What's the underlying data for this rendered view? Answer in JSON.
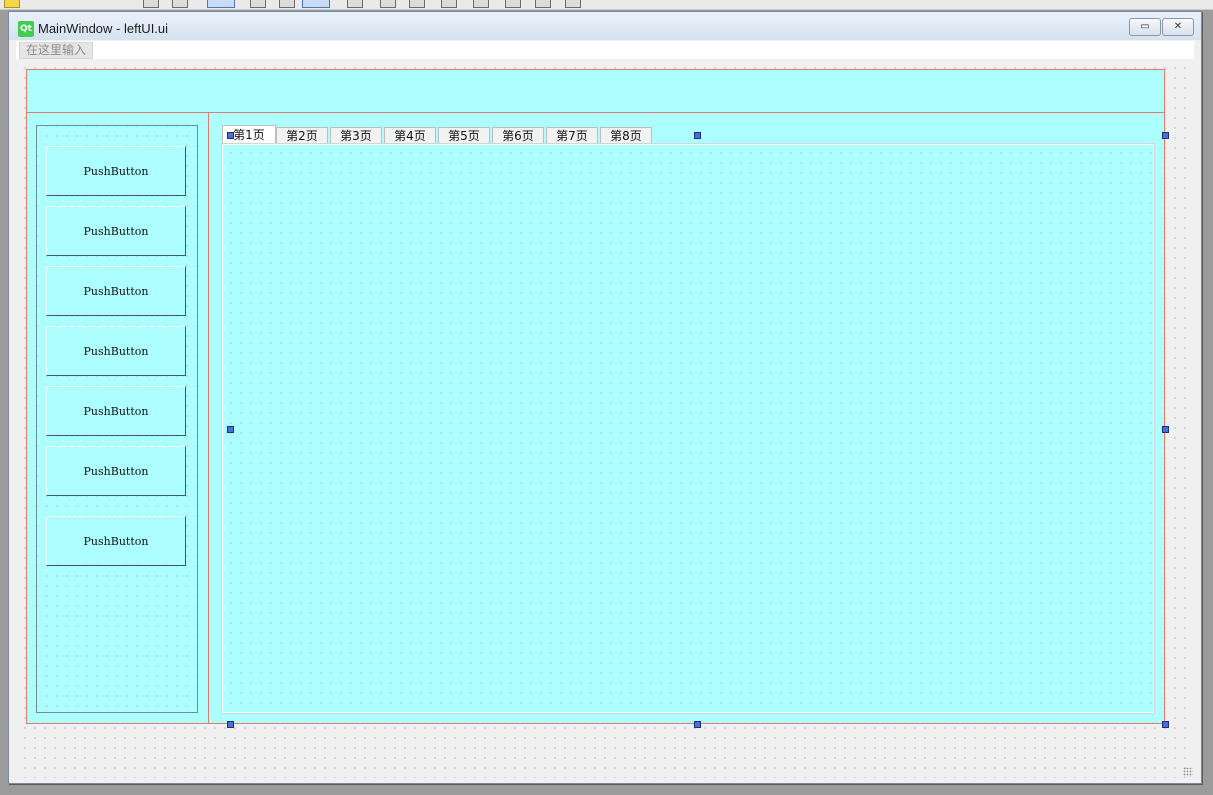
{
  "window": {
    "title": "MainWindow - leftUI.ui",
    "logo_text": "Qt",
    "minimize_symbol": "▭",
    "close_symbol": "✕"
  },
  "menubar": {
    "placeholder_entry": "在这里输入"
  },
  "left_panel": {
    "buttons": [
      {
        "label": "PushButton"
      },
      {
        "label": "PushButton"
      },
      {
        "label": "PushButton"
      },
      {
        "label": "PushButton"
      },
      {
        "label": "PushButton"
      },
      {
        "label": "PushButton"
      },
      {
        "label": "PushButton"
      }
    ]
  },
  "tabs": {
    "items": [
      {
        "label": "第1页"
      },
      {
        "label": "第2页"
      },
      {
        "label": "第3页"
      },
      {
        "label": "第4页"
      },
      {
        "label": "第5页"
      },
      {
        "label": "第6页"
      },
      {
        "label": "第7页"
      },
      {
        "label": "第8页"
      }
    ],
    "active_index": 0
  },
  "colors": {
    "widget_background": "#adffff",
    "layout_border": "#e37b6c",
    "selection_handle": "#4b6fd8",
    "window_background": "#f0f0f0"
  },
  "icons": [
    "qt-logo-icon",
    "minimize-icon",
    "close-icon",
    "size-grip-icon"
  ]
}
